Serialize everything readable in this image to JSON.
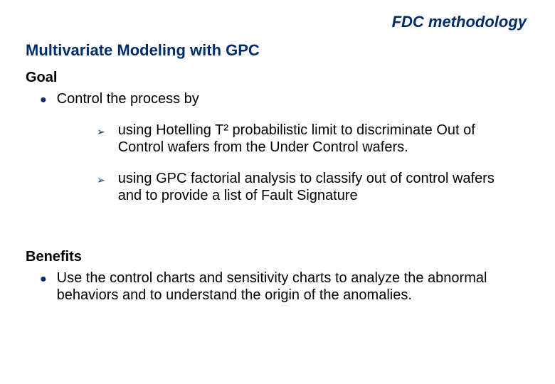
{
  "header": "FDC methodology",
  "subtitle": "Multivariate Modeling with GPC",
  "goal": {
    "heading": "Goal",
    "bullet": "Control the process by",
    "subs": [
      "using Hotelling T² probabilistic limit to discriminate Out of Control wafers from the Under Control wafers.",
      "using GPC factorial analysis to classify out of control wafers and to provide a list of Fault Signature"
    ]
  },
  "benefits": {
    "heading": "Benefits",
    "bullet": "Use the control charts and sensitivity charts to analyze the abnormal behaviors and to understand the origin of the anomalies."
  }
}
